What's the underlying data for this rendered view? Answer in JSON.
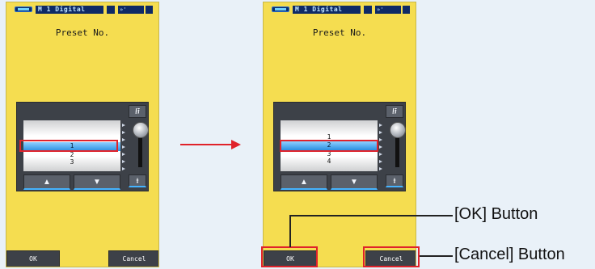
{
  "screens": [
    {
      "status": {
        "mode": "M 1 Digital",
        "icon": "»'"
      },
      "title": "Preset No.",
      "list": [
        "1",
        "2",
        "3"
      ],
      "selected_value": "1",
      "buttons": {
        "up": "▲",
        "down": "▼",
        "top": "⭿",
        "bottom": "⭽",
        "ok": "OK",
        "cancel": "Cancel"
      }
    },
    {
      "status": {
        "mode": "M 1 Digital",
        "icon": "»'"
      },
      "title": "Preset No.",
      "list": [
        "1",
        "2",
        "3",
        "4"
      ],
      "selected_value": "2",
      "buttons": {
        "up": "▲",
        "down": "▼",
        "top": "⭿",
        "bottom": "⭽",
        "ok": "OK",
        "cancel": "Cancel"
      }
    }
  ],
  "callouts": {
    "ok": "[OK] Button",
    "cancel": "[Cancel] Button"
  },
  "colors": {
    "screen_bg": "#f5dd50",
    "highlight": "#e0222a",
    "page_bg": "#e9f1f8"
  }
}
